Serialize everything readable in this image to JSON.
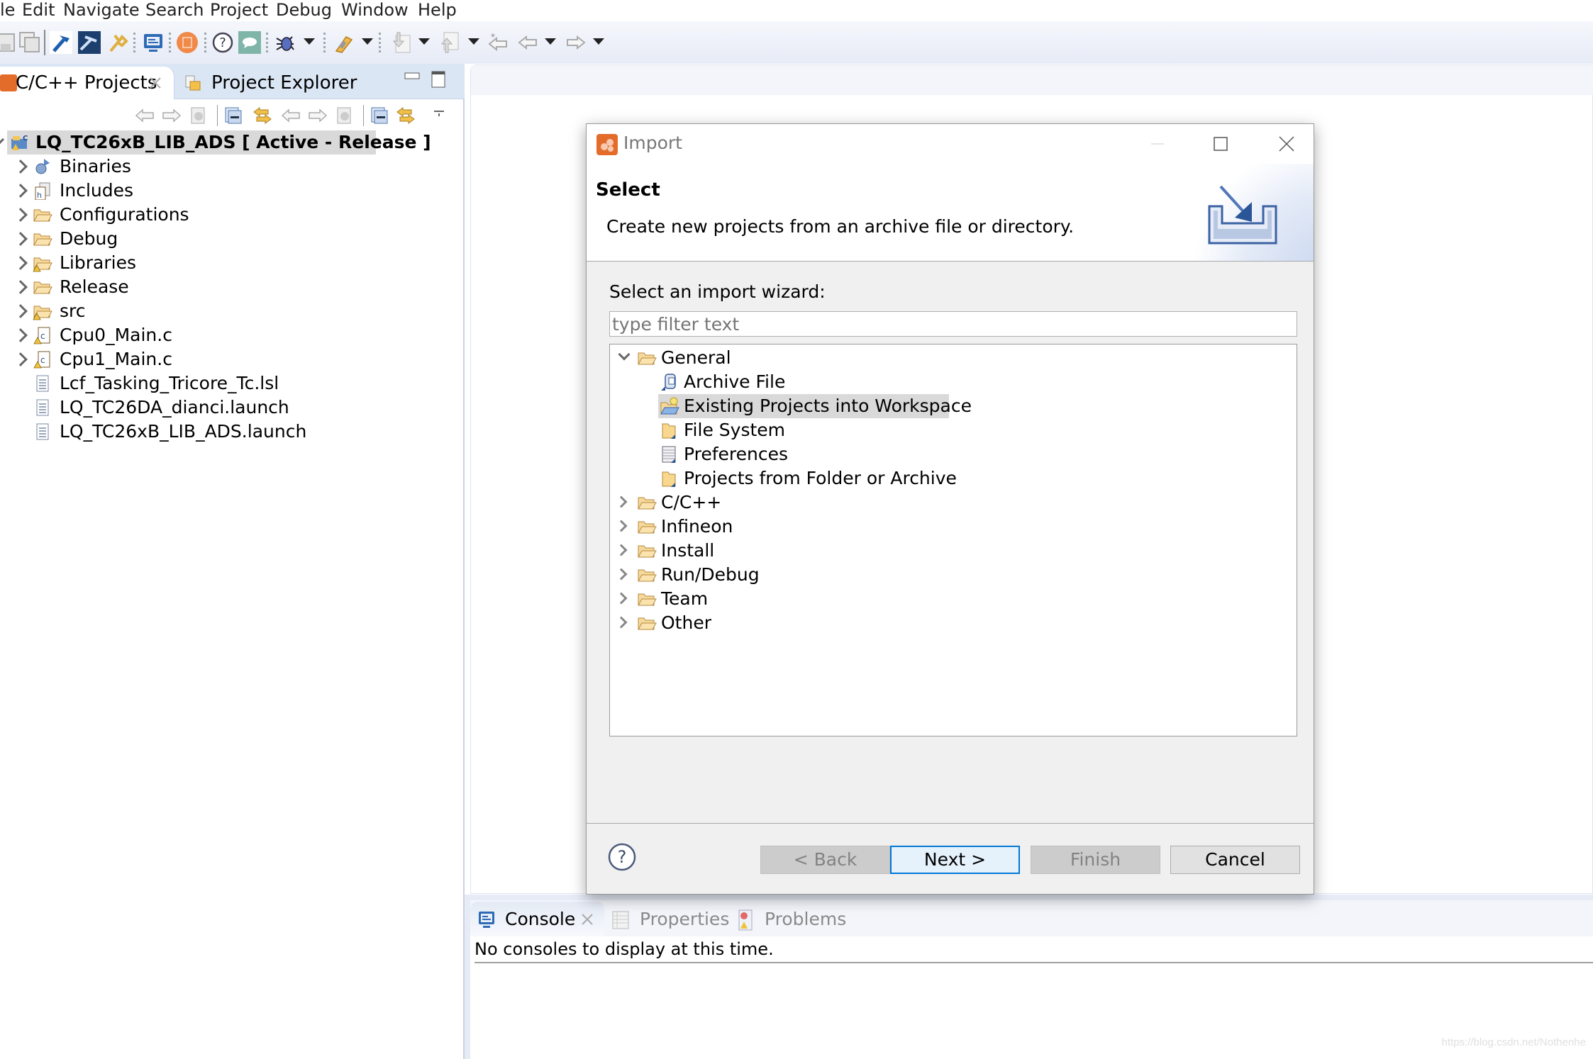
{
  "menubar": {
    "items": [
      "le",
      "Edit",
      "Navigate",
      "Search",
      "Project",
      "Debug",
      "Window",
      "Help"
    ]
  },
  "toolbar": {
    "icons": [
      "save-icon",
      "save-all-icon",
      "build-hammer-icon",
      "build-all-icon",
      "tools-wrench-icon",
      "console-monitor-icon",
      "chip-icon",
      "help-icon",
      "chat-icon",
      "debug-bug-icon",
      "launch-icon",
      "next-annotation-icon",
      "previous-annotation-icon",
      "last-edit-icon",
      "back-icon",
      "forward-icon"
    ]
  },
  "left_panel": {
    "tabs": [
      {
        "label": "C/C++ Projects",
        "active": true,
        "closable": true
      },
      {
        "label": "Project Explorer",
        "active": false
      }
    ],
    "tree": {
      "root": {
        "label": "LQ_TC26xB_LIB_ADS [ Active - Release ]",
        "expanded": true,
        "selected": true
      },
      "children": [
        {
          "label": "Binaries",
          "icon": "binaries-icon",
          "expandable": true
        },
        {
          "label": "Includes",
          "icon": "includes-icon",
          "expandable": true
        },
        {
          "label": "Configurations",
          "icon": "folder-icon",
          "expandable": true
        },
        {
          "label": "Debug",
          "icon": "folder-icon",
          "expandable": true
        },
        {
          "label": "Libraries",
          "icon": "folder-warning-icon",
          "expandable": true
        },
        {
          "label": "Release",
          "icon": "folder-icon",
          "expandable": true
        },
        {
          "label": "src",
          "icon": "folder-warning-icon",
          "expandable": true
        },
        {
          "label": "Cpu0_Main.c",
          "icon": "c-file-warning-icon",
          "expandable": true
        },
        {
          "label": "Cpu1_Main.c",
          "icon": "c-file-warning-icon",
          "expandable": true
        },
        {
          "label": "Lcf_Tasking_Tricore_Tc.lsl",
          "icon": "text-file-icon",
          "expandable": false
        },
        {
          "label": "LQ_TC26DA_dianci.launch",
          "icon": "text-file-icon",
          "expandable": false
        },
        {
          "label": "LQ_TC26xB_LIB_ADS.launch",
          "icon": "text-file-icon",
          "expandable": false
        }
      ]
    }
  },
  "dialog": {
    "title": "Import",
    "header_title": "Select",
    "header_desc": "Create new projects from an archive file or directory.",
    "wizard_label": "Select an import wizard:",
    "filter_placeholder": "type filter text",
    "tree": [
      {
        "label": "General",
        "level": 0,
        "expanded": true,
        "icon": "folder-open-icon"
      },
      {
        "label": "Archive File",
        "level": 1,
        "icon": "archive-file-icon"
      },
      {
        "label": "Existing Projects into Workspace",
        "level": 1,
        "icon": "existing-projects-icon",
        "selected": true
      },
      {
        "label": "File System",
        "level": 1,
        "icon": "file-system-icon"
      },
      {
        "label": "Preferences",
        "level": 1,
        "icon": "preferences-icon"
      },
      {
        "label": "Projects from Folder or Archive",
        "level": 1,
        "icon": "projects-folder-icon"
      },
      {
        "label": "C/C++",
        "level": 0,
        "expanded": false,
        "icon": "folder-open-icon"
      },
      {
        "label": "Infineon",
        "level": 0,
        "expanded": false,
        "icon": "folder-open-icon"
      },
      {
        "label": "Install",
        "level": 0,
        "expanded": false,
        "icon": "folder-open-icon"
      },
      {
        "label": "Run/Debug",
        "level": 0,
        "expanded": false,
        "icon": "folder-open-icon"
      },
      {
        "label": "Team",
        "level": 0,
        "expanded": false,
        "icon": "folder-open-icon"
      },
      {
        "label": "Other",
        "level": 0,
        "expanded": false,
        "icon": "folder-open-icon"
      }
    ],
    "buttons": {
      "back": "< Back",
      "next": "Next >",
      "finish": "Finish",
      "cancel": "Cancel"
    }
  },
  "bottom_panel": {
    "tabs": [
      {
        "label": "Console",
        "active": true,
        "closable": true
      },
      {
        "label": "Properties",
        "active": false
      },
      {
        "label": "Problems",
        "active": false
      }
    ],
    "console_message": "No consoles to display at this time."
  },
  "watermark": "https://blog.csdn.net/Nothenhe",
  "colors": {
    "accent_blue": "#0078d7",
    "selection_gray": "#d9d9d9",
    "eclipse_orange": "#e46c2a",
    "tab_blue": "#dbe6f4"
  }
}
